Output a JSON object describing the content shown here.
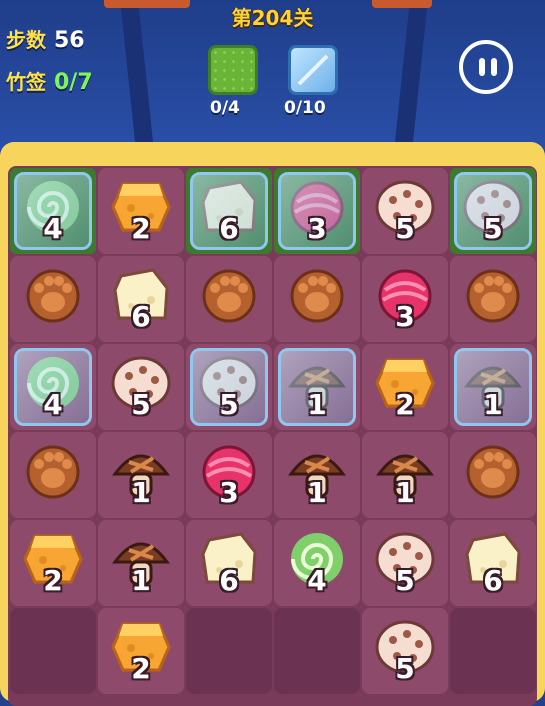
{
  "header": {
    "level_title": "第204关",
    "steps_label": "步数",
    "steps_value": "56",
    "bamboo_label": "竹签",
    "bamboo_value": "0/7"
  },
  "goals": [
    {
      "icon": "grass-tile-icon",
      "count": "0/4"
    },
    {
      "icon": "ice-tile-icon",
      "count": "0/10"
    }
  ],
  "colors": {
    "board_frame": "#f7d45c",
    "board_bg": "#7a3a5a",
    "level_text": "#ffd23a",
    "counter_green": "#7ef55a"
  },
  "board": {
    "rows": [
      [
        {
          "item": "swirl-candy-icon",
          "n": "4",
          "ice": true,
          "grass": true
        },
        {
          "item": "cheese-icon",
          "n": "2",
          "ice": false,
          "grass": false
        },
        {
          "item": "white-cheese-icon",
          "n": "6",
          "ice": true,
          "grass": true
        },
        {
          "item": "pink-candy-icon",
          "n": "3",
          "ice": true,
          "grass": true
        },
        {
          "item": "lotus-root-icon",
          "n": "5",
          "ice": false,
          "grass": false
        },
        {
          "item": "lotus-root-icon",
          "n": "5",
          "ice": true,
          "grass": true
        }
      ],
      [
        {
          "item": "paw-cookie-icon",
          "n": "",
          "ice": false,
          "grass": false
        },
        {
          "item": "white-cheese-icon",
          "n": "6",
          "ice": false,
          "grass": false
        },
        {
          "item": "paw-cookie-icon",
          "n": "",
          "ice": false,
          "grass": false
        },
        {
          "item": "paw-cookie-icon",
          "n": "",
          "ice": false,
          "grass": false
        },
        {
          "item": "pink-candy-icon",
          "n": "3",
          "ice": false,
          "grass": false
        },
        {
          "item": "paw-cookie-icon",
          "n": "",
          "ice": false,
          "grass": false
        }
      ],
      [
        {
          "item": "swirl-candy-icon",
          "n": "4",
          "ice": true,
          "grass": false
        },
        {
          "item": "lotus-root-icon",
          "n": "5",
          "ice": false,
          "grass": false
        },
        {
          "item": "lotus-root-icon",
          "n": "5",
          "ice": true,
          "grass": false
        },
        {
          "item": "mushroom-icon",
          "n": "1",
          "ice": true,
          "grass": false
        },
        {
          "item": "cheese-icon",
          "n": "2",
          "ice": false,
          "grass": false
        },
        {
          "item": "mushroom-icon",
          "n": "1",
          "ice": true,
          "grass": false
        }
      ],
      [
        {
          "item": "paw-cookie-icon",
          "n": "",
          "ice": false,
          "grass": false
        },
        {
          "item": "mushroom-icon",
          "n": "1",
          "ice": false,
          "grass": false
        },
        {
          "item": "pink-candy-icon",
          "n": "3",
          "ice": false,
          "grass": false
        },
        {
          "item": "mushroom-icon",
          "n": "1",
          "ice": false,
          "grass": false
        },
        {
          "item": "mushroom-icon",
          "n": "1",
          "ice": false,
          "grass": false
        },
        {
          "item": "paw-cookie-icon",
          "n": "",
          "ice": false,
          "grass": false
        }
      ],
      [
        {
          "item": "cheese-icon",
          "n": "2",
          "ice": false,
          "grass": false
        },
        {
          "item": "mushroom-icon",
          "n": "1",
          "ice": false,
          "grass": false
        },
        {
          "item": "white-cheese-icon",
          "n": "6",
          "ice": false,
          "grass": false
        },
        {
          "item": "swirl-candy-icon",
          "n": "4",
          "ice": false,
          "grass": false
        },
        {
          "item": "lotus-root-icon",
          "n": "5",
          "ice": false,
          "grass": false
        },
        {
          "item": "white-cheese-icon",
          "n": "6",
          "ice": false,
          "grass": false
        }
      ],
      [
        {
          "item": "",
          "n": "",
          "ice": false,
          "grass": false
        },
        {
          "item": "cheese-icon",
          "n": "2",
          "ice": false,
          "grass": false
        },
        {
          "item": "",
          "n": "",
          "ice": false,
          "grass": false
        },
        {
          "item": "",
          "n": "",
          "ice": false,
          "grass": false
        },
        {
          "item": "lotus-root-icon",
          "n": "5",
          "ice": false,
          "grass": false
        },
        {
          "item": "",
          "n": "",
          "ice": false,
          "grass": false
        }
      ]
    ]
  }
}
